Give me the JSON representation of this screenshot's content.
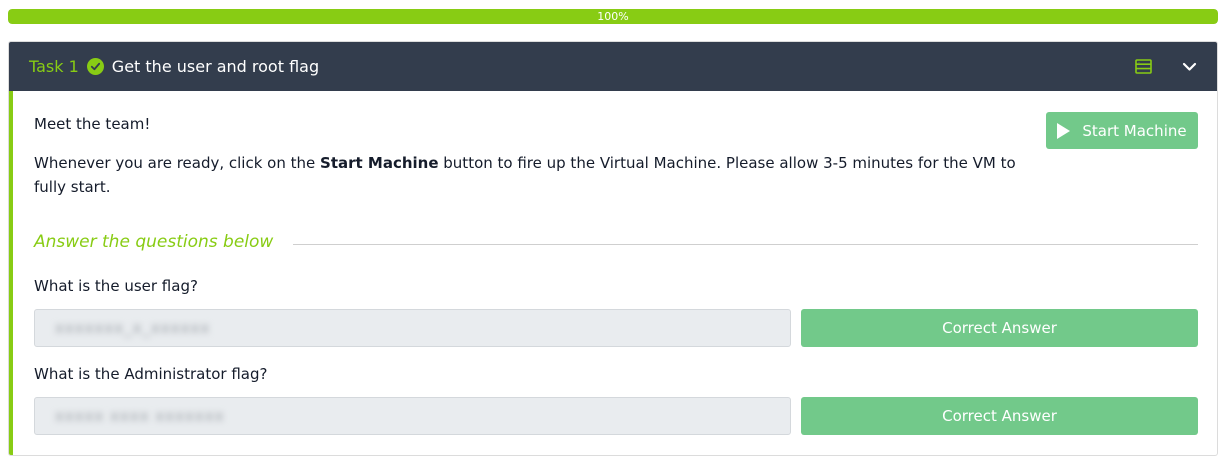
{
  "progress": {
    "percent": 100,
    "label": "100%",
    "color": "#88cc14"
  },
  "task": {
    "number_label": "Task 1",
    "completed": true,
    "title": "Get the user and root flag",
    "header_icons": [
      "server-list-icon",
      "chevron-down-icon"
    ]
  },
  "body": {
    "intro": "Meet the team!",
    "instruction_before": "Whenever you are ready, click on the ",
    "instruction_bold": "Start Machine",
    "instruction_after": " button to fire up the Virtual Machine. Please allow 3-5 minutes for the VM to fully start.",
    "start_button_label": "Start Machine"
  },
  "answers": {
    "heading": "Answer the questions below",
    "questions": [
      {
        "question": "What is the user flag?",
        "answer_masked": "xxxxxxx_x_xxxxxx",
        "button_label": "Correct Answer"
      },
      {
        "question": "What is the Administrator flag?",
        "answer_masked": "xxxxx xxxx xxxxxxx",
        "button_label": "Correct Answer"
      }
    ]
  },
  "colors": {
    "accent": "#88cc14",
    "header_bg": "#333d4d",
    "button_green": "#72c98a"
  }
}
